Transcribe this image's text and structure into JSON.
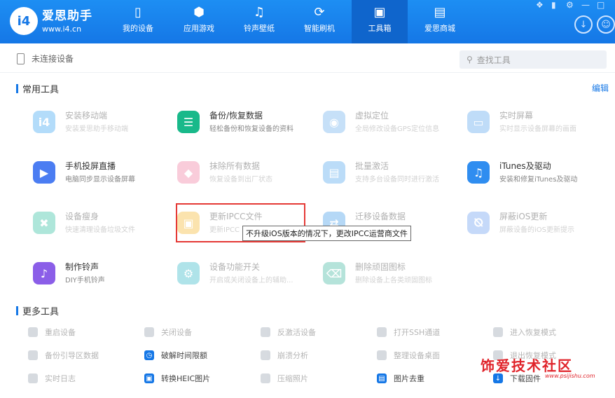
{
  "app": {
    "name": "爱思助手",
    "url": "www.i4.cn",
    "logo_text": "i4"
  },
  "nav": [
    {
      "label": "我的设备",
      "icon": "phone-icon",
      "active": false
    },
    {
      "label": "应用游戏",
      "icon": "cube-icon",
      "active": false
    },
    {
      "label": "铃声壁纸",
      "icon": "music-icon",
      "active": false
    },
    {
      "label": "智能刷机",
      "icon": "flash-icon",
      "active": false
    },
    {
      "label": "工具箱",
      "icon": "toolbox-icon",
      "active": true
    },
    {
      "label": "爱思商城",
      "icon": "bag-icon",
      "active": false
    }
  ],
  "device_status": "未连接设备",
  "search": {
    "placeholder": "查找工具"
  },
  "sections": {
    "common": "常用工具",
    "more": "更多工具",
    "edit": "编辑"
  },
  "common_tools": [
    {
      "title": "安装移动端",
      "desc": "安装爱思助手移动端",
      "icon": "i4-app-icon",
      "color": "#3aa6f4",
      "enabled": false
    },
    {
      "title": "备份/恢复数据",
      "desc": "轻松备份和恢复设备的资料",
      "icon": "layers-icon",
      "color": "#19b98a",
      "enabled": true
    },
    {
      "title": "虚拟定位",
      "desc": "全局修改设备GPS定位信息",
      "icon": "location-icon",
      "color": "#6cb0ef",
      "enabled": false
    },
    {
      "title": "实时屏幕",
      "desc": "实时显示设备屏幕的画面",
      "icon": "screen-icon",
      "color": "#58a6ef",
      "enabled": false
    },
    {
      "title": "手机投屏直播",
      "desc": "电脑同步显示设备屏幕",
      "icon": "cast-icon",
      "color": "#4b7df2",
      "enabled": true
    },
    {
      "title": "抹除所有数据",
      "desc": "恢复设备到出厂状态",
      "icon": "eraser-icon",
      "color": "#f07aa0",
      "enabled": false
    },
    {
      "title": "批量激活",
      "desc": "支持多台设备同时进行激活",
      "icon": "batch-icon",
      "color": "#4fa5ee",
      "enabled": false
    },
    {
      "title": "iTunes及驱动",
      "desc": "安装和修复iTunes及驱动",
      "icon": "itunes-icon",
      "color": "#2f8df0",
      "enabled": true
    },
    {
      "title": "设备瘦身",
      "desc": "快速清理设备垃圾文件",
      "icon": "broom-icon",
      "color": "#2ec0a0",
      "enabled": false
    },
    {
      "title": "更新IPCC文件",
      "desc": "更新IPCC",
      "icon": "folder-icon",
      "color": "#f5b82e",
      "enabled": false
    },
    {
      "title": "迁移设备数据",
      "desc": "设备",
      "icon": "migrate-icon",
      "color": "#3f9bea",
      "enabled": false
    },
    {
      "title": "屏蔽iOS更新",
      "desc": "屏蔽设备的iOS更新提示",
      "icon": "block-icon",
      "color": "#6a9ef0",
      "enabled": false
    },
    {
      "title": "制作铃声",
      "desc": "DIY手机铃声",
      "icon": "ringtone-icon",
      "color": "#8b5ee8",
      "enabled": true
    },
    {
      "title": "设备功能开关",
      "desc": "开启或关闭设备上的辅助...",
      "icon": "switch-icon",
      "color": "#2fb7c7",
      "enabled": false
    },
    {
      "title": "删除顽固图标",
      "desc": "删除设备上各类顽固图标",
      "icon": "trash-icon",
      "color": "#3fb8a0",
      "enabled": false
    }
  ],
  "tooltip": "不升级iOS版本的情况下，更改IPCC运营商文件",
  "more_tools": [
    {
      "label": "重启设备",
      "icon": "restart-icon",
      "enabled": false,
      "color": "#9aa5b1"
    },
    {
      "label": "关闭设备",
      "icon": "power-icon",
      "enabled": false,
      "color": "#9aa5b1"
    },
    {
      "label": "反激活设备",
      "icon": "deactivate-icon",
      "enabled": false,
      "color": "#9aa5b1"
    },
    {
      "label": "打开SSH通道",
      "icon": "ssh-icon",
      "enabled": false,
      "color": "#9aa5b1"
    },
    {
      "label": "进入恢复模式",
      "icon": "recovery-icon",
      "enabled": false,
      "color": "#9aa5b1"
    },
    {
      "label": "备份引导区数据",
      "icon": "backup-boot-icon",
      "enabled": false,
      "color": "#9aa5b1"
    },
    {
      "label": "破解时间限额",
      "icon": "clock-icon",
      "enabled": true,
      "color": "#1577e6"
    },
    {
      "label": "崩溃分析",
      "icon": "crash-icon",
      "enabled": false,
      "color": "#9aa5b1"
    },
    {
      "label": "整理设备桌面",
      "icon": "desktop-icon",
      "enabled": false,
      "color": "#9aa5b1"
    },
    {
      "label": "退出恢复模式",
      "icon": "exit-recovery-icon",
      "enabled": false,
      "color": "#9aa5b1"
    },
    {
      "label": "实时日志",
      "icon": "log-icon",
      "enabled": false,
      "color": "#9aa5b1"
    },
    {
      "label": "转换HEIC图片",
      "icon": "heic-icon",
      "enabled": true,
      "color": "#1577e6"
    },
    {
      "label": "压缩照片",
      "icon": "compress-icon",
      "enabled": false,
      "color": "#9aa5b1"
    },
    {
      "label": "图片去重",
      "icon": "dedupe-icon",
      "enabled": true,
      "color": "#1577e6"
    },
    {
      "label": "下载固件",
      "icon": "download-icon",
      "enabled": true,
      "color": "#1577e6"
    }
  ],
  "watermark": {
    "text": "饰爱技术社区",
    "url": "www.psijishu.com"
  }
}
